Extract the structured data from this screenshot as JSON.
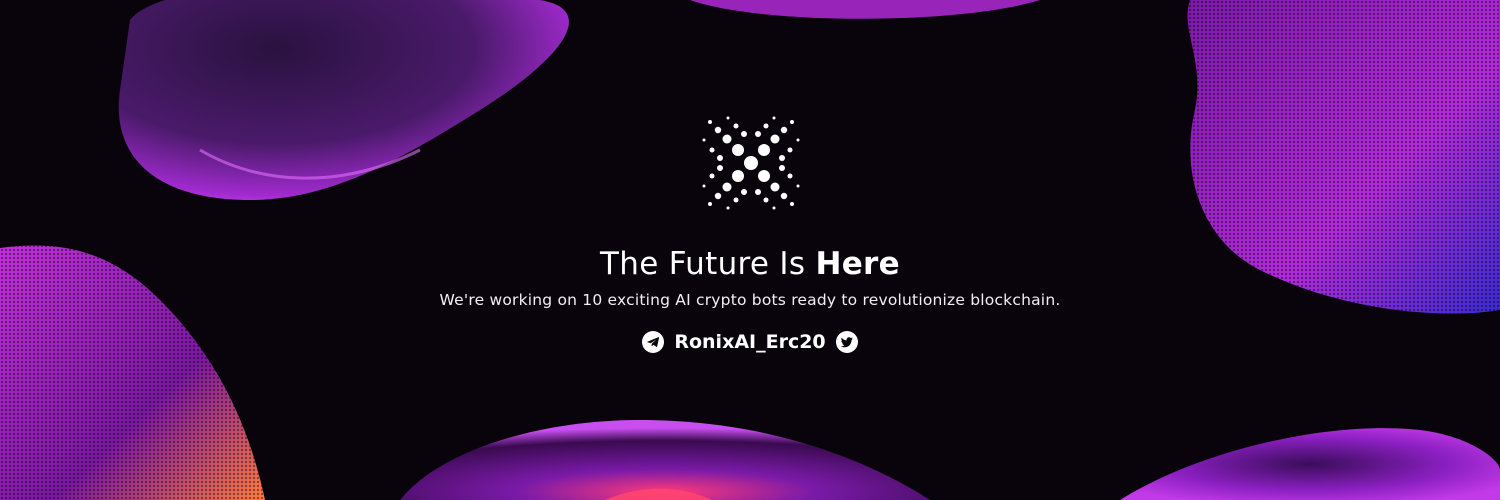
{
  "headline": {
    "regular": "The Future Is",
    "bold": "Here"
  },
  "tagline": "We're working on 10 exciting AI crypto bots ready to revolutionize blockchain.",
  "social": {
    "handle": "RonixAI_Erc20",
    "icons": [
      "telegram-icon",
      "twitter-icon"
    ]
  },
  "colors": {
    "background": "#09040c",
    "accent": "#b020d8",
    "text": "#ffffff"
  }
}
